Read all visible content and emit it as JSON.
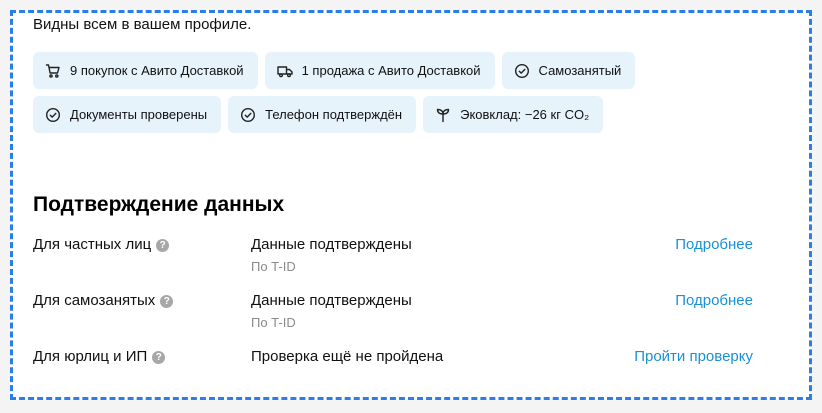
{
  "note": "Видны всем в вашем профиле.",
  "badges": [
    {
      "label": "9 покупок с Авито Доставкой",
      "icon": "cart-icon"
    },
    {
      "label": "1 продажа с Авито Доставкой",
      "icon": "truck-icon"
    },
    {
      "label": "Самозанятый",
      "icon": "check-circle-icon"
    },
    {
      "label": "Документы проверены",
      "icon": "check-circle-icon"
    },
    {
      "label": "Телефон подтверждён",
      "icon": "check-circle-icon"
    },
    {
      "label": "Эковклад: −26 кг CO₂",
      "icon": "sprout-icon"
    }
  ],
  "verification": {
    "title": "Подтверждение данных",
    "rows": [
      {
        "label": "Для частных лиц",
        "status": "Данные подтверждены",
        "method": "По T-ID",
        "link": "Подробнее"
      },
      {
        "label": "Для самозанятых",
        "status": "Данные подтверждены",
        "method": "По T-ID",
        "link": "Подробнее"
      },
      {
        "label": "Для юрлиц и ИП",
        "status": "Проверка ещё не пройдена",
        "method": "",
        "link": "Пройти проверку"
      }
    ],
    "help_glyph": "?"
  },
  "colors": {
    "badge_bg": "#e6f3fb",
    "link": "#1a91d6",
    "frame": "#2b7de9"
  }
}
